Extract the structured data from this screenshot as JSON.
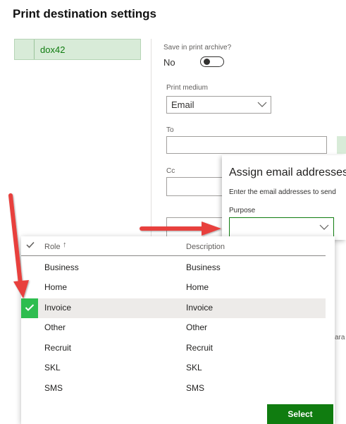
{
  "page": {
    "title": "Print destination settings"
  },
  "left_list": {
    "selected_item": "dox42"
  },
  "archive": {
    "label": "Save in print archive?",
    "value": "No"
  },
  "print_medium": {
    "label": "Print medium",
    "value": "Email"
  },
  "to_field": {
    "label": "To",
    "value": ""
  },
  "cc_field": {
    "label": "Cc",
    "value": ""
  },
  "assign_panel": {
    "title": "Assign email addresses",
    "description": "Enter the email addresses to send",
    "purpose_label": "Purpose",
    "purpose_value": ""
  },
  "dropdown": {
    "header": {
      "role": "Role",
      "sort_arrow": "↑",
      "description": "Description"
    },
    "rows": [
      {
        "role": "Business",
        "description": "Business",
        "selected": false
      },
      {
        "role": "Home",
        "description": "Home",
        "selected": false
      },
      {
        "role": "Invoice",
        "description": "Invoice",
        "selected": true
      },
      {
        "role": "Other",
        "description": "Other",
        "selected": false
      },
      {
        "role": "Recruit",
        "description": "Recruit",
        "selected": false
      },
      {
        "role": "SKL",
        "description": "SKL",
        "selected": false
      },
      {
        "role": "SMS",
        "description": "SMS",
        "selected": false
      }
    ],
    "select_label": "Select"
  },
  "partial_text": "ara",
  "colors": {
    "accent_green": "#107c10",
    "selected_check": "#2ebd4f",
    "annotation_arrow": "#e8413e"
  },
  "icons": [
    "chevron-down-icon",
    "checkmark-icon",
    "sort-ascending-icon",
    "annotation-arrow"
  ]
}
